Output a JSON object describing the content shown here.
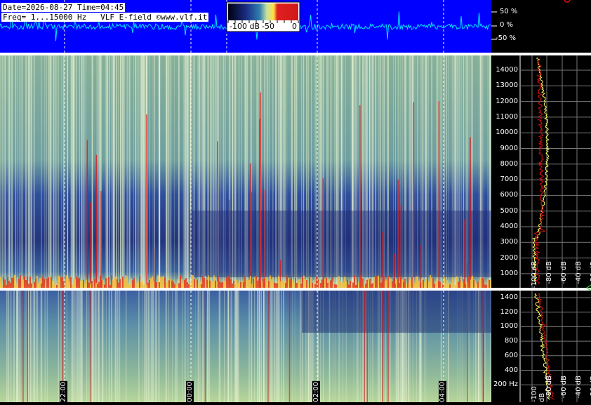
{
  "header": {
    "line1": "Date=2026-08-27 Time=04:45",
    "line2": "Freq= 1...15000 Hz   VLF E-field ©www.vlf.it"
  },
  "colorbar": {
    "labels": [
      "-100 dB",
      "-50",
      "0"
    ]
  },
  "waveform": {
    "labels": [
      "50 %",
      "0 %",
      "-50 %"
    ]
  },
  "upper_spectrum": {
    "freq_labels": [
      "14000",
      "13000",
      "12000",
      "11000",
      "10000",
      "9000",
      "8000",
      "7000",
      "6000",
      "5000",
      "4000",
      "3000",
      "2000",
      "1000"
    ],
    "db_labels": [
      "-100 dB",
      "-80 dB",
      "-60 dB",
      "-40 dB",
      "-20 dB"
    ]
  },
  "lower_spectrum": {
    "freq_labels": [
      "1400",
      "1200",
      "1000",
      "800",
      "600",
      "400",
      "200 Hz"
    ],
    "db_labels": [
      "-100 dB",
      "-80 dB",
      "-60 dB",
      "-40 dB",
      "-20 dB"
    ]
  },
  "time_labels": [
    "22:00",
    "00:00",
    "02:00",
    "04:00"
  ],
  "colors": {
    "waveform_bg": "#0000ff",
    "waveform_trace": "#00e5ff",
    "spectrum_yellow": "#ffff60",
    "spectrum_red": "#e01010",
    "separator": "#ffffff"
  },
  "icons": [
    "red-circle-icon",
    "green-arrow-icon"
  ]
}
